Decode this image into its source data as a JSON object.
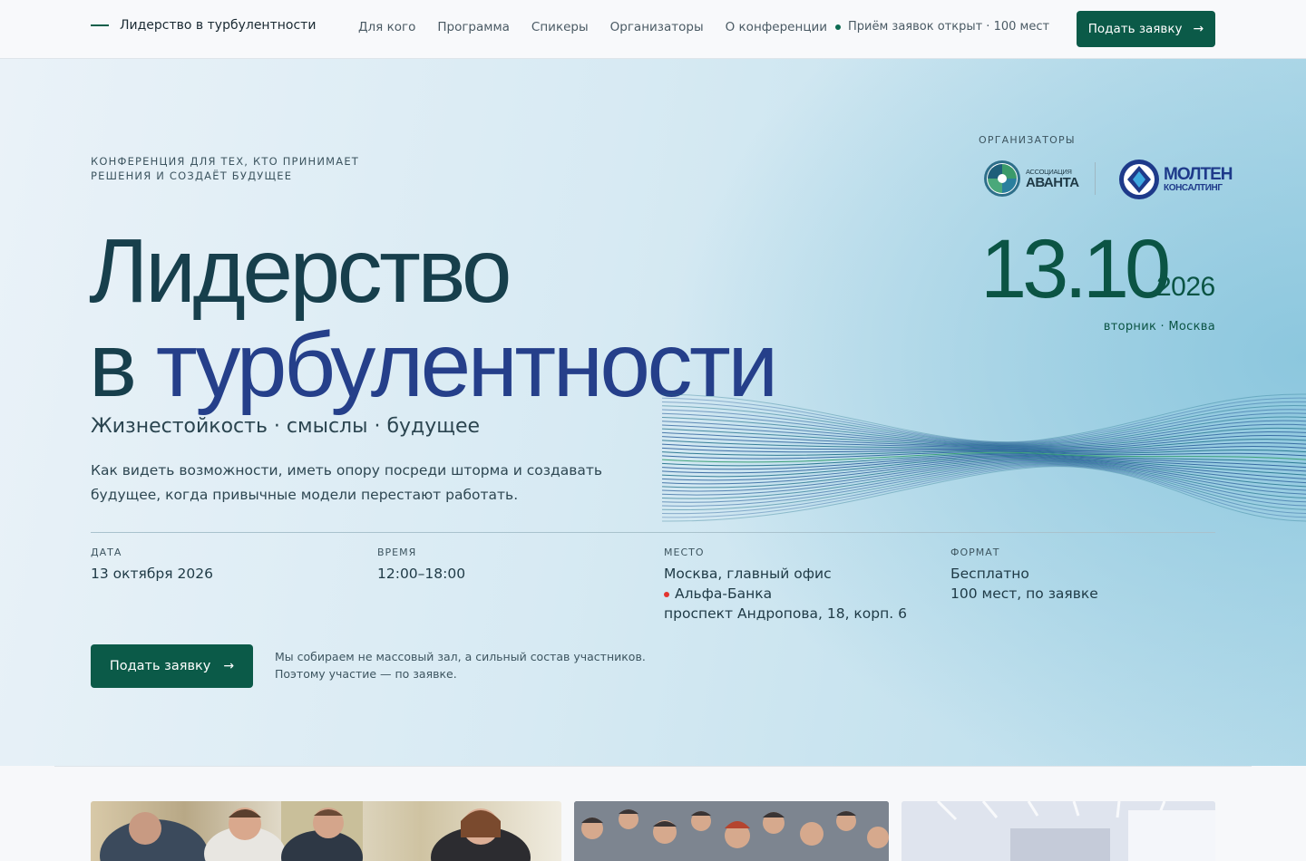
{
  "header": {
    "brand": "Лидерство в турбулентности",
    "nav": [
      "Для кого",
      "Программа",
      "Спикеры",
      "Организаторы",
      "О конференции"
    ],
    "status": "Приём заявок открыт · 100 мест",
    "cta": "Подать заявку",
    "accent_color": "#0b5a48"
  },
  "hero": {
    "kicker_line1": "Конференция для тех, кто принимает",
    "kicker_line2": "решения и создаёт будущее",
    "title_line1": "Лидерство",
    "title_line2_a": "в",
    "title_line2_b": "турбулентности",
    "subtitle": "Жизнестойкость · смыслы · будущее",
    "description": "Как видеть возможности, иметь опору посреди шторма и создавать будущее, когда привычные модели перестают работать.",
    "organizers_label": "ОРГАНИЗАТОРЫ",
    "logo1_small": "АССОЦИАЦИЯ",
    "logo1_big": "АВАНТА",
    "logo2_big": "МОЛТЕН",
    "logo2_small": "КОНСАЛТИНГ",
    "date_big": "13.10",
    "year": "2026",
    "weekday_city": "вторник · Москва"
  },
  "details": [
    {
      "label": "ДАТА",
      "lines": [
        "13 октября 2026"
      ]
    },
    {
      "label": "ВРЕМЯ",
      "lines": [
        "12:00–18:00"
      ]
    },
    {
      "label": "МЕСТО",
      "lines": [
        "Москва, главный офис",
        "Альфа-Банка",
        "проспект Андропова, 18, корп. 6"
      ]
    },
    {
      "label": "ФОРМАТ",
      "lines": [
        "Бесплатно",
        "100 мест, по заявке"
      ]
    }
  ],
  "cta_main": "Подать заявку",
  "note_line1": "Мы собираем не массовый зал, а сильный состав участников.",
  "note_line2": "Поэтому участие — по заявке."
}
